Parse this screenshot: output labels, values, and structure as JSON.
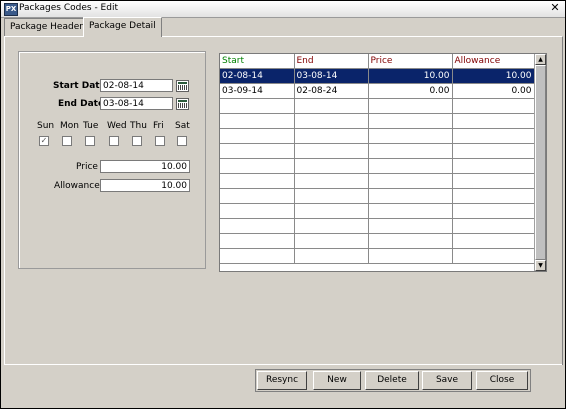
{
  "window": {
    "title": "Packages Codes - Edit",
    "close_glyph": "✕",
    "app_icon": "app-icon"
  },
  "tabs": [
    {
      "label": "Package Header",
      "active": false
    },
    {
      "label": "Package Detail",
      "active": true
    }
  ],
  "form": {
    "start_date_label": "Start Date",
    "start_date_value": "02-08-14",
    "end_date_label": "End Date",
    "end_date_value": "03-08-14",
    "days": [
      {
        "label": "Sun",
        "checked": true
      },
      {
        "label": "Mon",
        "checked": false
      },
      {
        "label": "Tue",
        "checked": false
      },
      {
        "label": "Wed",
        "checked": false
      },
      {
        "label": "Thu",
        "checked": false
      },
      {
        "label": "Fri",
        "checked": false
      },
      {
        "label": "Sat",
        "checked": false
      }
    ],
    "price_label": "Price",
    "price_value": "10.00",
    "allowance_label": "Allowance",
    "allowance_value": "10.00"
  },
  "grid": {
    "columns": [
      {
        "label": "Start",
        "color": "#008000"
      },
      {
        "label": "End",
        "color": "#800000"
      },
      {
        "label": "Price",
        "color": "#800000"
      },
      {
        "label": "Allowance",
        "color": "#800000"
      }
    ],
    "rows": [
      {
        "start": "02-08-14",
        "end": "03-08-14",
        "price": "10.00",
        "allowance": "10.00",
        "selected": true
      },
      {
        "start": "03-09-14",
        "end": "02-08-24",
        "price": "0.00",
        "allowance": "0.00",
        "selected": false
      }
    ],
    "empty_rows": 11
  },
  "buttons": {
    "resync": "Resync",
    "new": "New",
    "delete": "Delete",
    "save": "Save",
    "close": "Close"
  }
}
